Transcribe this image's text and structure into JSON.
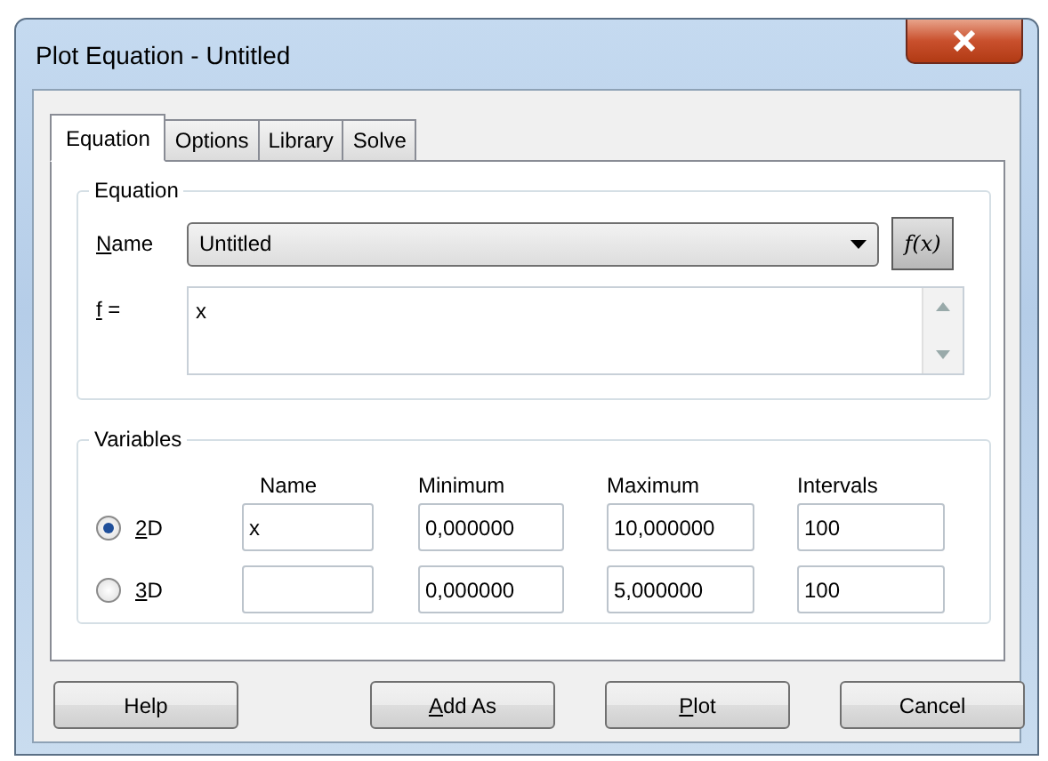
{
  "window": {
    "title": "Plot Equation - Untitled"
  },
  "tabs": [
    {
      "label": "Equation",
      "selected": true
    },
    {
      "label": "Options",
      "selected": false
    },
    {
      "label": "Library",
      "selected": false
    },
    {
      "label": "Solve",
      "selected": false
    }
  ],
  "equation_group": {
    "title": "Equation",
    "name_label": {
      "text": "Name",
      "mnemonic": true
    },
    "name_value": "Untitled",
    "function_button": "f(x)",
    "f_label": {
      "text": "f =",
      "mnemonic": true
    },
    "f_value": "x"
  },
  "variables_group": {
    "title": "Variables",
    "columns": [
      "Name",
      "Minimum",
      "Maximum",
      "Intervals"
    ],
    "rows": [
      {
        "label": "2D",
        "mnemonic": true,
        "selected": true,
        "name": "x",
        "minimum": "0,000000",
        "maximum": "10,000000",
        "intervals": "100"
      },
      {
        "label": "3D",
        "mnemonic": true,
        "selected": false,
        "minimum": "0,000000",
        "maximum": "5,000000",
        "intervals": "100"
      }
    ]
  },
  "buttons": [
    {
      "label": "Help",
      "mnemonic": false
    },
    {
      "label": "Add As",
      "mnemonic": true
    },
    {
      "label": "Plot",
      "mnemonic": true
    },
    {
      "label": "Cancel",
      "mnemonic": false
    }
  ]
}
